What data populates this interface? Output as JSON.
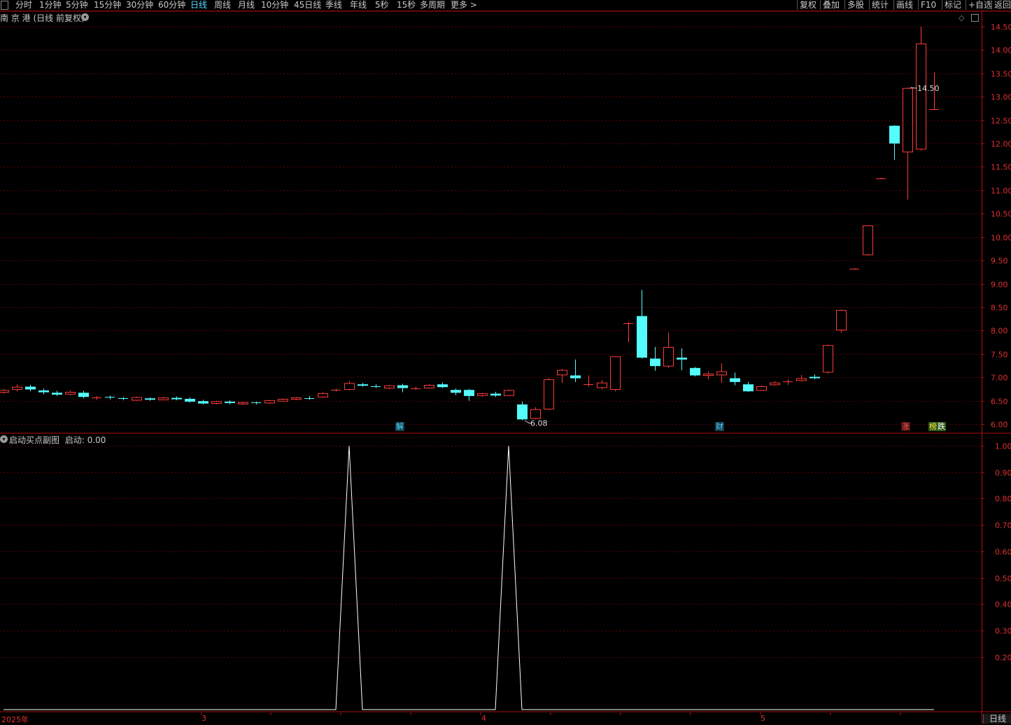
{
  "toolbar": {
    "periods": [
      "分时",
      "1分钟",
      "5分钟",
      "15分钟",
      "30分钟",
      "60分钟",
      "日线",
      "周线",
      "月线",
      "10分钟",
      "45日线",
      "季线",
      "年线",
      "5秒",
      "15秒",
      "多周期",
      "更多 >"
    ],
    "active": "日线",
    "right": [
      "复权",
      "叠加",
      "多股",
      "统计",
      "画线",
      "F10",
      "标记",
      "+自选",
      "返回"
    ]
  },
  "stock_title": "南 京 港 (日线 前复权)",
  "indicator": {
    "title": "启动买点副图",
    "value_label": "启动: 0.00"
  },
  "badges": [
    {
      "text": "解",
      "color": "#5ad8ff",
      "bg": "#123a4a"
    },
    {
      "text": "财",
      "color": "#5ad8ff",
      "bg": "#123a4a"
    },
    {
      "text": "涨",
      "color": "#ff6060",
      "bg": "#4a1010"
    },
    {
      "text": "榜",
      "color": "#ffe040",
      "bg": "#2c5a1a"
    },
    {
      "text": "跌",
      "color": "#ffffff",
      "bg": "#2c5a1a"
    }
  ],
  "x_ticks": [
    "2025年",
    "3",
    "4",
    "5"
  ],
  "period_button": "日线",
  "colors": {
    "up": "#ff3b3b",
    "down": "#54fcfc",
    "grid": "#5a0000",
    "axis": "#b01010",
    "line": "#ffffff"
  },
  "chart_data": [
    {
      "type": "candlestick",
      "title": "南 京 港 (日线 前复权)",
      "ylim": [
        5.85,
        14.62
      ],
      "y_ticks": [
        6.0,
        6.5,
        7.0,
        7.5,
        8.0,
        8.5,
        9.0,
        9.5,
        10.0,
        10.5,
        11.0,
        11.5,
        12.0,
        12.5,
        13.0,
        13.5,
        14.0,
        14.5
      ],
      "annotations": [
        {
          "text": "6.08",
          "index": 39
        },
        {
          "text": "14.50",
          "index": 68
        }
      ],
      "candles": [
        {
          "o": 6.68,
          "c": 6.72,
          "h": 6.75,
          "l": 6.65
        },
        {
          "o": 6.74,
          "c": 6.79,
          "h": 6.85,
          "l": 6.7
        },
        {
          "o": 6.8,
          "c": 6.74,
          "h": 6.84,
          "l": 6.7
        },
        {
          "o": 6.72,
          "c": 6.68,
          "h": 6.76,
          "l": 6.64
        },
        {
          "o": 6.67,
          "c": 6.63,
          "h": 6.71,
          "l": 6.6
        },
        {
          "o": 6.64,
          "c": 6.68,
          "h": 6.72,
          "l": 6.61
        },
        {
          "o": 6.67,
          "c": 6.58,
          "h": 6.71,
          "l": 6.55
        },
        {
          "o": 6.55,
          "c": 6.57,
          "h": 6.6,
          "l": 6.52
        },
        {
          "o": 6.58,
          "c": 6.56,
          "h": 6.61,
          "l": 6.53
        },
        {
          "o": 6.55,
          "c": 6.54,
          "h": 6.58,
          "l": 6.51
        },
        {
          "o": 6.51,
          "c": 6.57,
          "h": 6.59,
          "l": 6.5
        },
        {
          "o": 6.55,
          "c": 6.52,
          "h": 6.57,
          "l": 6.5
        },
        {
          "o": 6.52,
          "c": 6.56,
          "h": 6.58,
          "l": 6.51
        },
        {
          "o": 6.56,
          "c": 6.53,
          "h": 6.59,
          "l": 6.51
        },
        {
          "o": 6.54,
          "c": 6.48,
          "h": 6.57,
          "l": 6.46
        },
        {
          "o": 6.49,
          "c": 6.44,
          "h": 6.52,
          "l": 6.42
        },
        {
          "o": 6.44,
          "c": 6.48,
          "h": 6.5,
          "l": 6.42
        },
        {
          "o": 6.48,
          "c": 6.45,
          "h": 6.51,
          "l": 6.42
        },
        {
          "o": 6.43,
          "c": 6.46,
          "h": 6.48,
          "l": 6.41
        },
        {
          "o": 6.46,
          "c": 6.44,
          "h": 6.48,
          "l": 6.42
        },
        {
          "o": 6.45,
          "c": 6.5,
          "h": 6.52,
          "l": 6.43
        },
        {
          "o": 6.49,
          "c": 6.53,
          "h": 6.55,
          "l": 6.48
        },
        {
          "o": 6.53,
          "c": 6.56,
          "h": 6.58,
          "l": 6.51
        },
        {
          "o": 6.56,
          "c": 6.55,
          "h": 6.6,
          "l": 6.52
        },
        {
          "o": 6.58,
          "c": 6.65,
          "h": 6.68,
          "l": 6.57
        },
        {
          "o": 6.72,
          "c": 6.73,
          "h": 6.76,
          "l": 6.7
        },
        {
          "o": 6.74,
          "c": 6.87,
          "h": 6.92,
          "l": 6.72
        },
        {
          "o": 6.85,
          "c": 6.82,
          "h": 6.88,
          "l": 6.8
        },
        {
          "o": 6.81,
          "c": 6.8,
          "h": 6.85,
          "l": 6.77
        },
        {
          "o": 6.77,
          "c": 6.82,
          "h": 6.84,
          "l": 6.75
        },
        {
          "o": 6.83,
          "c": 6.77,
          "h": 6.86,
          "l": 6.68
        },
        {
          "o": 6.75,
          "c": 6.76,
          "h": 6.8,
          "l": 6.73
        },
        {
          "o": 6.77,
          "c": 6.83,
          "h": 6.85,
          "l": 6.76
        },
        {
          "o": 6.85,
          "c": 6.79,
          "h": 6.89,
          "l": 6.77
        },
        {
          "o": 6.73,
          "c": 6.67,
          "h": 6.76,
          "l": 6.62
        },
        {
          "o": 6.73,
          "c": 6.6,
          "h": 6.75,
          "l": 6.5
        },
        {
          "o": 6.61,
          "c": 6.65,
          "h": 6.67,
          "l": 6.58
        },
        {
          "o": 6.65,
          "c": 6.61,
          "h": 6.69,
          "l": 6.58
        },
        {
          "o": 6.61,
          "c": 6.72,
          "h": 6.74,
          "l": 6.6
        },
        {
          "o": 6.42,
          "c": 6.1,
          "h": 6.48,
          "l": 6.08
        },
        {
          "o": 6.12,
          "c": 6.31,
          "h": 6.36,
          "l": 6.1
        },
        {
          "o": 6.32,
          "c": 6.95,
          "h": 6.98,
          "l": 6.3
        },
        {
          "o": 7.05,
          "c": 7.15,
          "h": 7.18,
          "l": 6.88
        },
        {
          "o": 7.04,
          "c": 6.98,
          "h": 7.38,
          "l": 6.9
        },
        {
          "o": 6.85,
          "c": 6.86,
          "h": 7.04,
          "l": 6.8
        },
        {
          "o": 6.78,
          "c": 6.88,
          "h": 6.94,
          "l": 6.74
        },
        {
          "o": 6.74,
          "c": 7.44,
          "h": 7.45,
          "l": 6.7
        },
        {
          "o": 8.15,
          "c": 8.16,
          "h": 8.18,
          "l": 7.75
        },
        {
          "o": 8.31,
          "c": 7.42,
          "h": 8.87,
          "l": 7.4
        },
        {
          "o": 7.4,
          "c": 7.24,
          "h": 7.65,
          "l": 7.14
        },
        {
          "o": 7.24,
          "c": 7.64,
          "h": 7.95,
          "l": 7.2
        },
        {
          "o": 7.42,
          "c": 7.38,
          "h": 7.62,
          "l": 7.15
        },
        {
          "o": 7.2,
          "c": 7.04,
          "h": 7.22,
          "l": 7.02
        },
        {
          "o": 7.04,
          "c": 7.07,
          "h": 7.12,
          "l": 6.96
        },
        {
          "o": 7.05,
          "c": 7.12,
          "h": 7.3,
          "l": 6.88
        },
        {
          "o": 6.98,
          "c": 6.9,
          "h": 7.1,
          "l": 6.83
        },
        {
          "o": 6.85,
          "c": 6.7,
          "h": 6.9,
          "l": 6.69
        },
        {
          "o": 6.72,
          "c": 6.8,
          "h": 6.82,
          "l": 6.71
        },
        {
          "o": 6.84,
          "c": 6.88,
          "h": 6.92,
          "l": 6.82
        },
        {
          "o": 6.89,
          "c": 6.91,
          "h": 6.96,
          "l": 6.84
        },
        {
          "o": 6.93,
          "c": 6.97,
          "h": 7.05,
          "l": 6.91
        },
        {
          "o": 7.01,
          "c": 6.98,
          "h": 7.06,
          "l": 6.96
        },
        {
          "o": 7.11,
          "c": 7.68,
          "h": 7.7,
          "l": 7.08
        },
        {
          "o": 8.01,
          "c": 8.43,
          "h": 8.45,
          "l": 7.95
        },
        {
          "o": 9.31,
          "c": 9.32,
          "h": 9.33,
          "l": 9.3
        },
        {
          "o": 9.62,
          "c": 10.24,
          "h": 10.25,
          "l": 9.6
        },
        {
          "o": 11.25,
          "c": 11.26,
          "h": 11.27,
          "l": 11.24
        },
        {
          "o": 12.38,
          "c": 12.0,
          "h": 12.39,
          "l": 11.65
        },
        {
          "o": 11.82,
          "c": 13.18,
          "h": 13.2,
          "l": 10.8
        },
        {
          "o": 11.88,
          "c": 14.13,
          "h": 14.5,
          "l": 11.85
        },
        {
          "o": 12.73,
          "c": 12.74,
          "h": 13.52,
          "l": 12.72
        }
      ]
    },
    {
      "type": "line",
      "title": "启动买点副图",
      "ylim": [
        0.0,
        1.04
      ],
      "y_ticks": [
        0.2,
        0.3,
        0.4,
        0.5,
        0.6,
        0.7,
        0.8,
        0.9,
        1.0
      ],
      "series": [
        {
          "name": "启动",
          "values": [
            0,
            0,
            0,
            0,
            0,
            0,
            0,
            0,
            0,
            0,
            0,
            0,
            0,
            0,
            0,
            0,
            0,
            0,
            0,
            0,
            0,
            0,
            0,
            0,
            0,
            0,
            1,
            0,
            0,
            0,
            0,
            0,
            0,
            0,
            0,
            0,
            0,
            0,
            1,
            0,
            0,
            0,
            0,
            0,
            0,
            0,
            0,
            0,
            0,
            0,
            0,
            0,
            0,
            0,
            0,
            0,
            0,
            0,
            0,
            0,
            0,
            0,
            0,
            0,
            0,
            0,
            0,
            0,
            0,
            0,
            0
          ]
        }
      ]
    }
  ]
}
